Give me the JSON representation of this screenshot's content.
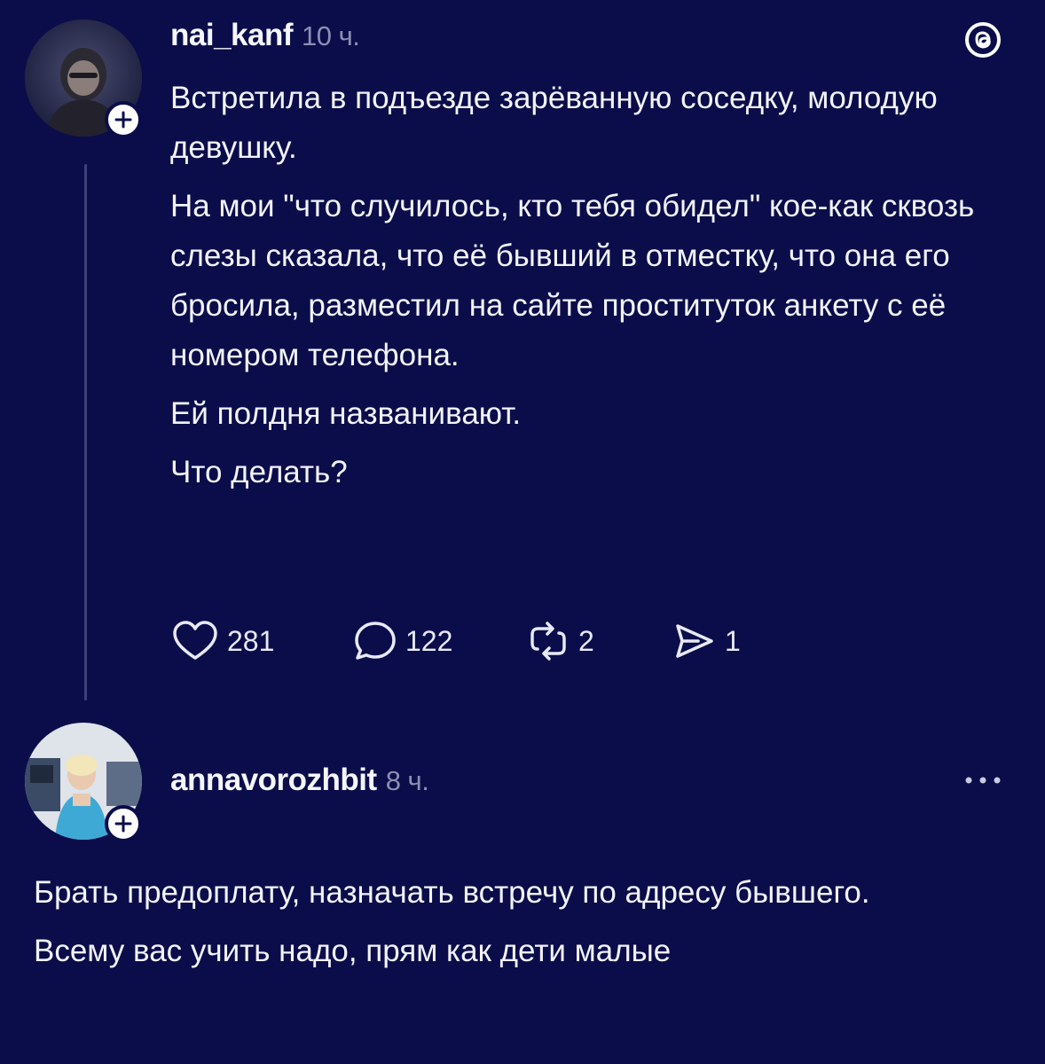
{
  "post": {
    "username": "nai_kanf",
    "time": "10 ч.",
    "paragraphs": [
      "Встретила в подъезде зарёванную соседку, молодую девушку.",
      "На мои \"что случилось, кто тебя обидел\" кое-как сквозь слезы сказала, что её бывший в отместку, что она его бросила, разместил на сайте проституток анкету с её номером телефона.",
      "Ей полдня названивают.",
      "Что делать?"
    ],
    "likes": "281",
    "comments": "122",
    "reposts": "2",
    "shares": "1",
    "logo_icon": "threads-logo-icon"
  },
  "reply": {
    "username": "annavorozhbit",
    "time": "8 ч.",
    "paragraphs": [
      "Брать предоплату, назначать встречу по адресу бывшего.",
      "Всему вас учить надо, прям как дети малые"
    ],
    "more_icon": "more-options-icon"
  },
  "colors": {
    "background": "#0b0d4a",
    "text": "#f2f3fb",
    "muted": "#8c8fb3",
    "thread_line": "#3d4078"
  }
}
